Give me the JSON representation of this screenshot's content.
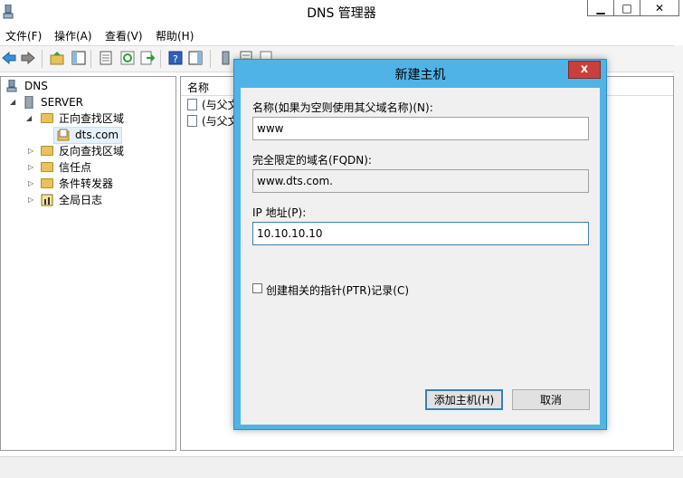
{
  "window": {
    "title": "DNS 管理器",
    "buttons": {
      "minimize": "▁",
      "maximize": "□",
      "close": "✕"
    }
  },
  "menu": [
    "文件(F)",
    "操作(A)",
    "查看(V)",
    "帮助(H)"
  ],
  "toolbar": {
    "icons": [
      "back-icon",
      "forward-icon",
      "up-folder-icon",
      "show-hide-tree-icon",
      "properties-icon",
      "refresh-icon",
      "export-icon",
      "help-icon",
      "show-pane-icon",
      "server-icon",
      "record-icon",
      "new-record-icon"
    ]
  },
  "tree": {
    "root": "DNS",
    "server": "SERVER",
    "forward_zone": "正向查找区域",
    "zone": "dts.com",
    "reverse_zone": "反向查找区域",
    "trust_points": "信任点",
    "conditional_forwarders": "条件转发器",
    "global_logs": "全局日志"
  },
  "list": {
    "column_name": "名称",
    "rows": [
      "(与父文",
      "(与父文"
    ]
  },
  "dialog": {
    "title": "新建主机",
    "close": "x",
    "name_label": "名称(如果为空则使用其父域名称)(N):",
    "name_value": "www",
    "fqdn_label": "完全限定的域名(FQDN):",
    "fqdn_value": "www.dts.com.",
    "ip_label": "IP 地址(P):",
    "ip_value": "10.10.10.10",
    "ptr_label": "创建相关的指针(PTR)记录(C)",
    "ptr_checked": false,
    "add_button": "添加主机(H)",
    "cancel_button": "取消"
  },
  "colors": {
    "dialog_frame": "#4fb3e8",
    "close_red": "#c7413a",
    "folder": "#e8c25a"
  }
}
